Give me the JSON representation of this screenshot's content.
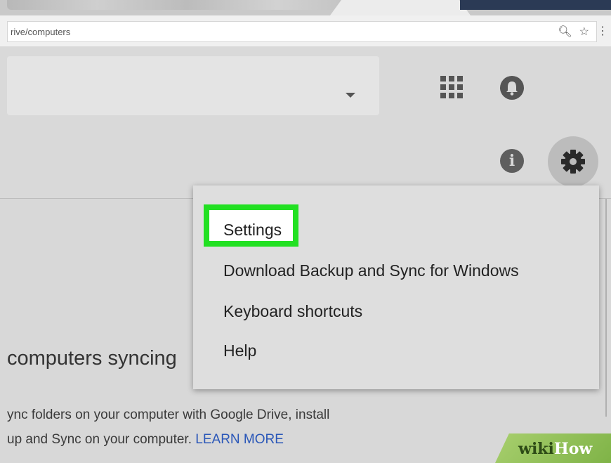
{
  "browser": {
    "url": "rive/computers",
    "zoom_icon": "zoom-icon",
    "star_icon": "star-icon",
    "menu_icon": "more-vert-icon"
  },
  "header": {
    "dropdown_icon": "caret-down-icon",
    "apps_icon": "apps-grid-icon",
    "notifications_icon": "bell-icon"
  },
  "toolbar": {
    "info_icon": "info-icon",
    "settings_icon": "gear-icon",
    "info_glyph": "i"
  },
  "content": {
    "heading": "computers syncing",
    "desc_line1": "ync folders on your computer with Google Drive, install",
    "desc_line2": "up and Sync on your computer. ",
    "learn_more": "LEARN MORE"
  },
  "settings_menu": {
    "items": [
      {
        "label": "Settings"
      },
      {
        "label": "Download Backup and Sync for Windows"
      },
      {
        "label": "Keyboard shortcuts"
      },
      {
        "label": "Help"
      }
    ],
    "highlight_color": "#22e022"
  },
  "watermark": {
    "part1": "wiki",
    "part2": "How"
  }
}
